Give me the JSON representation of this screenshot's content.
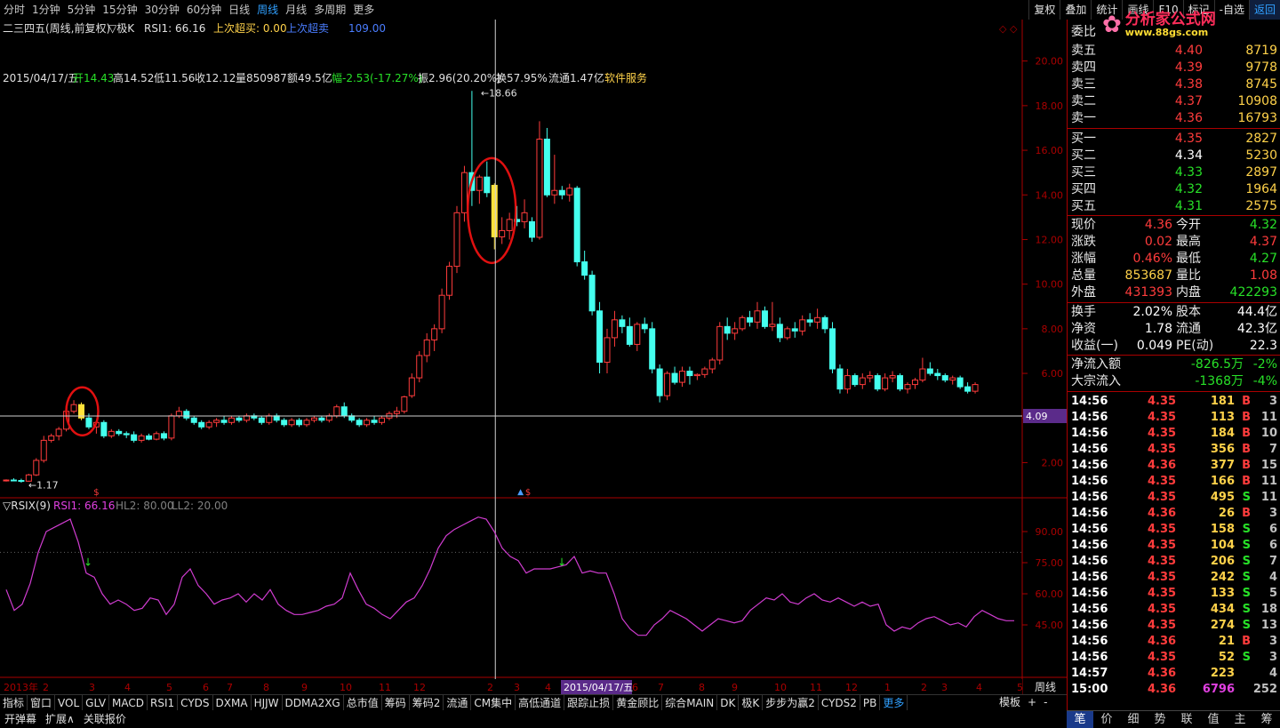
{
  "top_periods": [
    "分时",
    "1分钟",
    "5分钟",
    "15分钟",
    "30分钟",
    "60分钟",
    "日线",
    "周线",
    "月线",
    "多周期",
    "更多"
  ],
  "top_periods_active": "周线",
  "top_tools": [
    "复权",
    "叠加",
    "统计",
    "画线",
    "F10",
    "标记",
    "-自选",
    "返回"
  ],
  "logo": {
    "name": "分析家公式网",
    "url": "www.88gs.com"
  },
  "stock_header": {
    "name": "二三四五(周线,前复权)",
    "marker": "▽极K",
    "rsi": "RSI1: 66.16",
    "l1": "上次超买: 0.00",
    "l2": "上次超卖",
    "l2v": "109.00"
  },
  "info_line": {
    "date": "2015/04/17/五",
    "open": "开14.43",
    "high": "高14.52",
    "low": "低11.56",
    "close": "收12.12",
    "vol": "量850987",
    "amt": "额49.5亿",
    "chg": "幅-2.53(-17.27%)",
    "amp": "振2.96(20.20%)",
    "turn": "换57.95%",
    "float": "流通1.47亿",
    "sector": "软件服务"
  },
  "main_axis": [
    "20.00",
    "18.00",
    "16.00",
    "14.00",
    "12.00",
    "10.00",
    "8.00",
    "6.00",
    "4.00",
    "2.00"
  ],
  "crosshair_price": "4.09",
  "max_label": "18.66",
  "min_label": "1.17",
  "rsix_header": {
    "name": "▽RSIX(9)",
    "rsi1": "RSI1: 66.16",
    "hl2": "HL2: 80.00",
    "ll2": "LL2: 20.00"
  },
  "rsix_axis": [
    "90.00",
    "75.00",
    "60.00",
    "45.00"
  ],
  "time_axis": {
    "year": "2013年",
    "labels": [
      "2",
      "3",
      "4",
      "5",
      "6",
      "7",
      "8",
      "9",
      "10",
      "11",
      "12",
      "2",
      "3",
      "4",
      "6",
      "7",
      "8",
      "9",
      "10",
      "11",
      "12",
      "1",
      "2",
      "3",
      "4",
      "5"
    ],
    "cursor_date": "2015/04/17/五",
    "period": "周线"
  },
  "bottom_tabs": [
    "指标",
    "窗口",
    "VOL",
    "GLV",
    "MACD",
    "RSI1",
    "CYDS",
    "DXMA",
    "HJJW",
    "DDMA2XG",
    "总市值",
    "筹码",
    "筹码2",
    "流通",
    "CM集中",
    "高低通道",
    "跟踪止损",
    "黄金顾比",
    "综合MAIN",
    "DK",
    "极K",
    "步步为赢2",
    "CYDS2",
    "PB",
    "更多"
  ],
  "bottom_right": [
    "模板",
    "+",
    "-"
  ],
  "bottom_tabs2": [
    "开弹幕",
    "扩展∧",
    "关联报价"
  ],
  "right_tabs": [
    "笔",
    "价",
    "细",
    "势",
    "联",
    "值",
    "主",
    "筹"
  ],
  "right_tabs_active": "笔",
  "orderbook": {
    "ratio_label": "委比",
    "sell": [
      {
        "l": "卖五",
        "p": "4.40",
        "v": "8719"
      },
      {
        "l": "卖四",
        "p": "4.39",
        "v": "9778"
      },
      {
        "l": "卖三",
        "p": "4.38",
        "v": "8745"
      },
      {
        "l": "卖二",
        "p": "4.37",
        "v": "10908"
      },
      {
        "l": "卖一",
        "p": "4.36",
        "v": "16793"
      }
    ],
    "buy": [
      {
        "l": "买一",
        "p": "4.35",
        "v": "2827"
      },
      {
        "l": "买二",
        "p": "4.34",
        "v": "5230"
      },
      {
        "l": "买三",
        "p": "4.33",
        "v": "2897"
      },
      {
        "l": "买四",
        "p": "4.32",
        "v": "1964"
      },
      {
        "l": "买五",
        "p": "4.31",
        "v": "2575"
      }
    ]
  },
  "quote": [
    {
      "l1": "现价",
      "v1": "4.36",
      "l2": "今开",
      "v2": "4.32",
      "c1": "red",
      "c2": "grn"
    },
    {
      "l1": "涨跌",
      "v1": "0.02",
      "l2": "最高",
      "v2": "4.37",
      "c1": "red",
      "c2": "red"
    },
    {
      "l1": "涨幅",
      "v1": "0.46%",
      "l2": "最低",
      "v2": "4.27",
      "c1": "red",
      "c2": "grn"
    },
    {
      "l1": "总量",
      "v1": "853687",
      "l2": "量比",
      "v2": "1.08",
      "c1": "yel",
      "c2": "red"
    },
    {
      "l1": "外盘",
      "v1": "431393",
      "l2": "内盘",
      "v2": "422293",
      "c1": "red",
      "c2": "grn"
    }
  ],
  "quote2": [
    {
      "l1": "换手",
      "v1": "2.02%",
      "l2": "股本",
      "v2": "44.4亿"
    },
    {
      "l1": "净资",
      "v1": "1.78",
      "l2": "流通",
      "v2": "42.3亿"
    },
    {
      "l1": "收益(一)",
      "v1": "0.049",
      "l2": "PE(动)",
      "v2": "22.3"
    }
  ],
  "flow": [
    {
      "l": "净流入额",
      "v": "-826.5万",
      "p": "-2%"
    },
    {
      "l": "大宗流入",
      "v": "-1368万",
      "p": "-4%"
    }
  ],
  "ticks": [
    {
      "t": "14:56",
      "p": "4.35",
      "q": "181",
      "d": "B",
      "n": "3"
    },
    {
      "t": "14:56",
      "p": "4.35",
      "q": "113",
      "d": "B",
      "n": "11"
    },
    {
      "t": "14:56",
      "p": "4.35",
      "q": "184",
      "d": "B",
      "n": "10"
    },
    {
      "t": "14:56",
      "p": "4.35",
      "q": "356",
      "d": "B",
      "n": "7"
    },
    {
      "t": "14:56",
      "p": "4.36",
      "q": "377",
      "d": "B",
      "n": "15"
    },
    {
      "t": "14:56",
      "p": "4.35",
      "q": "166",
      "d": "B",
      "n": "11"
    },
    {
      "t": "14:56",
      "p": "4.35",
      "q": "495",
      "d": "S",
      "n": "11"
    },
    {
      "t": "14:56",
      "p": "4.36",
      "q": "26",
      "d": "B",
      "n": "3"
    },
    {
      "t": "14:56",
      "p": "4.35",
      "q": "158",
      "d": "S",
      "n": "6"
    },
    {
      "t": "14:56",
      "p": "4.35",
      "q": "104",
      "d": "S",
      "n": "6"
    },
    {
      "t": "14:56",
      "p": "4.35",
      "q": "206",
      "d": "S",
      "n": "7"
    },
    {
      "t": "14:56",
      "p": "4.35",
      "q": "242",
      "d": "S",
      "n": "4"
    },
    {
      "t": "14:56",
      "p": "4.35",
      "q": "133",
      "d": "S",
      "n": "5"
    },
    {
      "t": "14:56",
      "p": "4.35",
      "q": "434",
      "d": "S",
      "n": "18"
    },
    {
      "t": "14:56",
      "p": "4.35",
      "q": "274",
      "d": "S",
      "n": "13"
    },
    {
      "t": "14:56",
      "p": "4.36",
      "q": "21",
      "d": "B",
      "n": "3"
    },
    {
      "t": "14:56",
      "p": "4.35",
      "q": "52",
      "d": "S",
      "n": "3"
    },
    {
      "t": "14:57",
      "p": "4.36",
      "q": "223",
      "d": "",
      "n": "4"
    },
    {
      "t": "15:00",
      "p": "4.36",
      "q": "6796",
      "d": "",
      "n": "252"
    }
  ],
  "candles": [
    [
      1.2,
      1.25,
      1.15,
      1.22
    ],
    [
      1.22,
      1.3,
      1.18,
      1.2
    ],
    [
      1.2,
      1.28,
      1.1,
      1.17
    ],
    [
      1.17,
      1.5,
      1.15,
      1.45
    ],
    [
      1.45,
      2.2,
      1.4,
      2.1
    ],
    [
      2.1,
      3.2,
      2.0,
      3.0
    ],
    [
      3.0,
      3.3,
      2.9,
      3.2
    ],
    [
      3.2,
      3.6,
      3.0,
      3.5
    ],
    [
      3.5,
      4.5,
      3.4,
      4.3
    ],
    [
      4.3,
      4.8,
      4.2,
      4.6
    ],
    [
      4.6,
      4.7,
      3.9,
      4.0
    ],
    [
      4.0,
      4.2,
      3.5,
      3.6
    ],
    [
      3.6,
      3.9,
      3.3,
      3.8
    ],
    [
      3.8,
      3.9,
      3.1,
      3.2
    ],
    [
      3.2,
      3.5,
      3.1,
      3.4
    ],
    [
      3.4,
      3.5,
      3.2,
      3.3
    ],
    [
      3.3,
      3.4,
      3.1,
      3.25
    ],
    [
      3.25,
      3.4,
      2.9,
      3.0
    ],
    [
      3.0,
      3.3,
      2.9,
      3.2
    ],
    [
      3.2,
      3.3,
      3.0,
      3.05
    ],
    [
      3.05,
      3.4,
      3.0,
      3.3
    ],
    [
      3.3,
      3.4,
      3.0,
      3.1
    ],
    [
      3.1,
      4.2,
      3.0,
      4.1
    ],
    [
      4.1,
      4.5,
      4.0,
      4.3
    ],
    [
      4.3,
      4.4,
      3.9,
      4.0
    ],
    [
      4.0,
      4.1,
      3.7,
      3.8
    ],
    [
      3.8,
      3.9,
      3.5,
      3.6
    ],
    [
      3.6,
      3.9,
      3.5,
      3.8
    ],
    [
      3.8,
      4.0,
      3.6,
      3.9
    ],
    [
      3.9,
      4.1,
      3.7,
      3.8
    ],
    [
      3.8,
      4.1,
      3.7,
      4.0
    ],
    [
      4.0,
      4.1,
      3.8,
      3.9
    ],
    [
      3.9,
      4.2,
      3.8,
      4.1
    ],
    [
      4.1,
      4.2,
      3.9,
      4.0
    ],
    [
      4.0,
      4.1,
      3.7,
      3.8
    ],
    [
      3.8,
      4.2,
      3.7,
      4.1
    ],
    [
      4.1,
      4.2,
      3.8,
      3.9
    ],
    [
      3.9,
      4.0,
      3.6,
      3.7
    ],
    [
      3.7,
      4.0,
      3.6,
      3.9
    ],
    [
      3.9,
      4.0,
      3.6,
      3.7
    ],
    [
      3.7,
      4.0,
      3.6,
      3.9
    ],
    [
      3.9,
      4.1,
      3.8,
      4.0
    ],
    [
      4.0,
      4.1,
      3.8,
      3.9
    ],
    [
      3.9,
      4.2,
      3.8,
      4.1
    ],
    [
      4.1,
      4.6,
      4.0,
      4.5
    ],
    [
      4.5,
      4.7,
      4.0,
      4.1
    ],
    [
      4.1,
      4.2,
      3.8,
      3.9
    ],
    [
      3.9,
      4.0,
      3.6,
      3.7
    ],
    [
      3.7,
      4.0,
      3.6,
      3.9
    ],
    [
      3.9,
      4.1,
      3.7,
      3.8
    ],
    [
      3.8,
      4.1,
      3.7,
      4.0
    ],
    [
      4.0,
      4.3,
      3.9,
      4.2
    ],
    [
      4.2,
      4.5,
      4.0,
      4.3
    ],
    [
      4.3,
      5.0,
      4.2,
      4.95
    ],
    [
      5.0,
      6.0,
      4.9,
      5.8
    ],
    [
      5.8,
      7.0,
      5.6,
      6.8
    ],
    [
      6.8,
      7.8,
      6.5,
      7.5
    ],
    [
      7.5,
      8.2,
      7.0,
      8.0
    ],
    [
      8.0,
      9.8,
      7.8,
      9.5
    ],
    [
      9.5,
      11.0,
      9.3,
      10.8
    ],
    [
      10.8,
      13.5,
      10.5,
      13.2
    ],
    [
      13.2,
      15.3,
      12.8,
      15.0
    ],
    [
      15.0,
      18.66,
      13.5,
      14.2
    ],
    [
      14.2,
      14.9,
      13.6,
      14.8
    ],
    [
      14.8,
      15.5,
      13.9,
      14.1
    ],
    [
      14.43,
      14.52,
      11.56,
      12.12
    ],
    [
      12.12,
      13.0,
      11.8,
      12.4
    ],
    [
      12.4,
      13.2,
      12.0,
      12.9
    ],
    [
      12.9,
      13.5,
      12.6,
      12.8
    ],
    [
      12.8,
      13.8,
      12.5,
      13.2
    ],
    [
      12.8,
      13.0,
      11.9,
      12.1
    ],
    [
      12.1,
      17.3,
      12.0,
      16.5
    ],
    [
      16.5,
      17.0,
      13.9,
      14.0
    ],
    [
      14.0,
      15.8,
      13.6,
      14.2
    ],
    [
      14.2,
      14.4,
      13.8,
      14.0
    ],
    [
      14.0,
      14.5,
      13.7,
      14.3
    ],
    [
      14.3,
      14.4,
      10.8,
      11.0
    ],
    [
      11.0,
      11.5,
      10.2,
      10.4
    ],
    [
      10.4,
      10.6,
      8.6,
      8.8
    ],
    [
      8.8,
      9.2,
      6.0,
      6.5
    ],
    [
      6.5,
      8.0,
      6.0,
      7.6
    ],
    [
      7.6,
      8.8,
      7.2,
      8.4
    ],
    [
      8.4,
      8.6,
      7.8,
      8.1
    ],
    [
      8.1,
      8.5,
      7.2,
      7.3
    ],
    [
      7.3,
      8.3,
      7.0,
      8.2
    ],
    [
      8.2,
      8.5,
      7.8,
      8.0
    ],
    [
      8.0,
      8.3,
      6.0,
      6.2
    ],
    [
      6.2,
      6.4,
      4.7,
      5.0
    ],
    [
      5.0,
      6.1,
      4.8,
      6.0
    ],
    [
      6.0,
      6.3,
      5.5,
      5.6
    ],
    [
      5.6,
      6.3,
      5.4,
      6.1
    ],
    [
      6.1,
      6.3,
      5.5,
      5.9
    ],
    [
      5.9,
      6.0,
      5.7,
      5.95
    ],
    [
      5.95,
      6.3,
      5.8,
      6.2
    ],
    [
      6.2,
      6.7,
      6.0,
      6.6
    ],
    [
      6.6,
      8.3,
      6.4,
      8.1
    ],
    [
      8.1,
      8.5,
      7.5,
      7.8
    ],
    [
      7.8,
      8.3,
      7.5,
      8.0
    ],
    [
      8.0,
      8.6,
      7.9,
      8.5
    ],
    [
      8.5,
      8.8,
      8.1,
      8.3
    ],
    [
      8.3,
      9.2,
      8.0,
      8.8
    ],
    [
      8.8,
      9.0,
      8.0,
      8.1
    ],
    [
      8.1,
      9.2,
      7.9,
      8.2
    ],
    [
      8.2,
      8.5,
      7.4,
      7.6
    ],
    [
      7.6,
      8.1,
      7.5,
      8.0
    ],
    [
      8.0,
      8.3,
      7.6,
      7.9
    ],
    [
      7.9,
      8.6,
      7.7,
      8.4
    ],
    [
      8.4,
      8.7,
      8.1,
      8.3
    ],
    [
      8.3,
      8.9,
      8.0,
      8.5
    ],
    [
      8.5,
      8.6,
      7.8,
      8.0
    ],
    [
      8.0,
      8.3,
      6.0,
      6.2
    ],
    [
      6.2,
      6.4,
      5.1,
      5.3
    ],
    [
      5.3,
      6.2,
      5.1,
      5.9
    ],
    [
      5.9,
      6.0,
      5.4,
      5.5
    ],
    [
      5.5,
      6.0,
      5.3,
      5.8
    ],
    [
      5.8,
      6.1,
      5.6,
      5.9
    ],
    [
      5.9,
      6.0,
      5.2,
      5.3
    ],
    [
      5.3,
      6.0,
      5.2,
      5.8
    ],
    [
      5.8,
      6.1,
      5.6,
      5.9
    ],
    [
      5.9,
      6.0,
      5.2,
      5.3
    ],
    [
      5.3,
      5.6,
      5.1,
      5.5
    ],
    [
      5.5,
      5.8,
      5.3,
      5.7
    ],
    [
      5.7,
      6.7,
      5.6,
      6.2
    ],
    [
      6.2,
      6.5,
      5.9,
      6.0
    ],
    [
      6.0,
      6.2,
      5.7,
      5.9
    ],
    [
      5.9,
      6.0,
      5.6,
      5.7
    ],
    [
      5.7,
      5.9,
      5.5,
      5.8
    ],
    [
      5.8,
      5.9,
      5.3,
      5.4
    ],
    [
      5.4,
      5.6,
      5.1,
      5.2
    ],
    [
      5.2,
      5.6,
      5.1,
      5.5
    ]
  ],
  "rsix": [
    62,
    52,
    55,
    65,
    80,
    90,
    92,
    94,
    96,
    85,
    70,
    68,
    60,
    55,
    57,
    55,
    52,
    53,
    58,
    57,
    50,
    55,
    68,
    72,
    64,
    60,
    55,
    57,
    58,
    60,
    56,
    60,
    57,
    62,
    55,
    52,
    50,
    50,
    51,
    52,
    54,
    55,
    58,
    70,
    62,
    55,
    53,
    50,
    48,
    52,
    56,
    58,
    64,
    72,
    82,
    88,
    91,
    93,
    95,
    97,
    96,
    90,
    82,
    78,
    76,
    70,
    72,
    72,
    72,
    73,
    74,
    78,
    70,
    71,
    70,
    70,
    60,
    48,
    43,
    40,
    40,
    45,
    48,
    52,
    50,
    48,
    45,
    42,
    45,
    48,
    47,
    46,
    47,
    52,
    55,
    58,
    57,
    60,
    56,
    55,
    58,
    60,
    57,
    56,
    58,
    56,
    54,
    56,
    54,
    55,
    45,
    42,
    44,
    43,
    46,
    48,
    49,
    47,
    45,
    46,
    44,
    49,
    52,
    50,
    48,
    47,
    47
  ]
}
